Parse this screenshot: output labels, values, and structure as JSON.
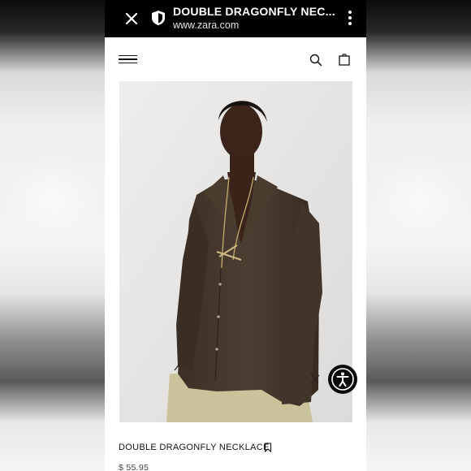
{
  "browser": {
    "page_title": "DOUBLE DRAGONFLY NEC...",
    "domain": "www.zara.com",
    "close_icon": "close-icon",
    "security_icon": "shield-icon",
    "menu_icon": "more-vertical-icon"
  },
  "site_header": {
    "menu_icon": "hamburger-menu-icon",
    "search_icon": "search-icon",
    "bag_icon": "shopping-bag-icon"
  },
  "product": {
    "name": "DOUBLE DRAGONFLY NECKLACE",
    "price": "$ 55.95",
    "bookmark_icon": "bookmark-icon",
    "image_alt": "Model wearing a brown sheer shirt and a long gold dragonfly necklace"
  },
  "accessibility": {
    "icon": "accessibility-icon"
  }
}
